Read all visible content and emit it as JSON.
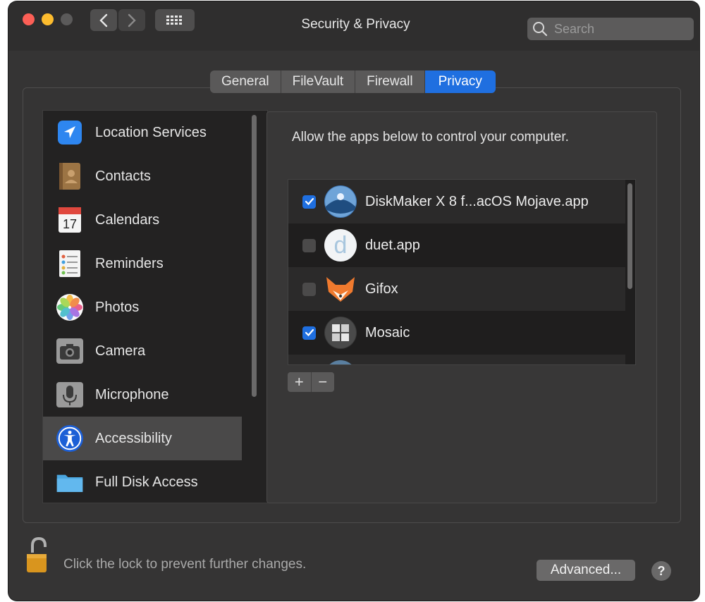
{
  "window": {
    "title": "Security & Privacy",
    "search": {
      "placeholder": "Search",
      "value": ""
    }
  },
  "tabs": [
    {
      "label": "General"
    },
    {
      "label": "FileVault"
    },
    {
      "label": "Firewall"
    },
    {
      "label": "Privacy",
      "active": true
    }
  ],
  "sidebar": {
    "items": [
      {
        "label": "Location Services",
        "icon": "location-arrow-icon"
      },
      {
        "label": "Contacts",
        "icon": "contacts-book-icon"
      },
      {
        "label": "Calendars",
        "icon": "calendar-icon"
      },
      {
        "label": "Reminders",
        "icon": "reminders-list-icon"
      },
      {
        "label": "Photos",
        "icon": "photos-flower-icon"
      },
      {
        "label": "Camera",
        "icon": "camera-icon"
      },
      {
        "label": "Microphone",
        "icon": "microphone-icon"
      },
      {
        "label": "Accessibility",
        "icon": "accessibility-icon",
        "selected": true
      },
      {
        "label": "Full Disk Access",
        "icon": "folder-icon"
      }
    ]
  },
  "main": {
    "prompt": "Allow the apps below to control your computer.",
    "apps": [
      {
        "label": "DiskMaker X 8 f...acOS Mojave.app",
        "checked": true,
        "icon": "diskmaker-icon"
      },
      {
        "label": "duet.app",
        "checked": false,
        "icon": "duet-icon"
      },
      {
        "label": "Gifox",
        "checked": false,
        "icon": "gifox-fox-icon"
      },
      {
        "label": "Mosaic",
        "checked": true,
        "icon": "mosaic-icon"
      }
    ],
    "add_label": "+",
    "remove_label": "−"
  },
  "footer": {
    "lock_text": "Click the lock to prevent further changes.",
    "advanced_label": "Advanced...",
    "help_label": "?"
  },
  "colors": {
    "accent": "#1f6fe0",
    "window_bg": "#353434",
    "list_bg": "#1f1e1e"
  }
}
